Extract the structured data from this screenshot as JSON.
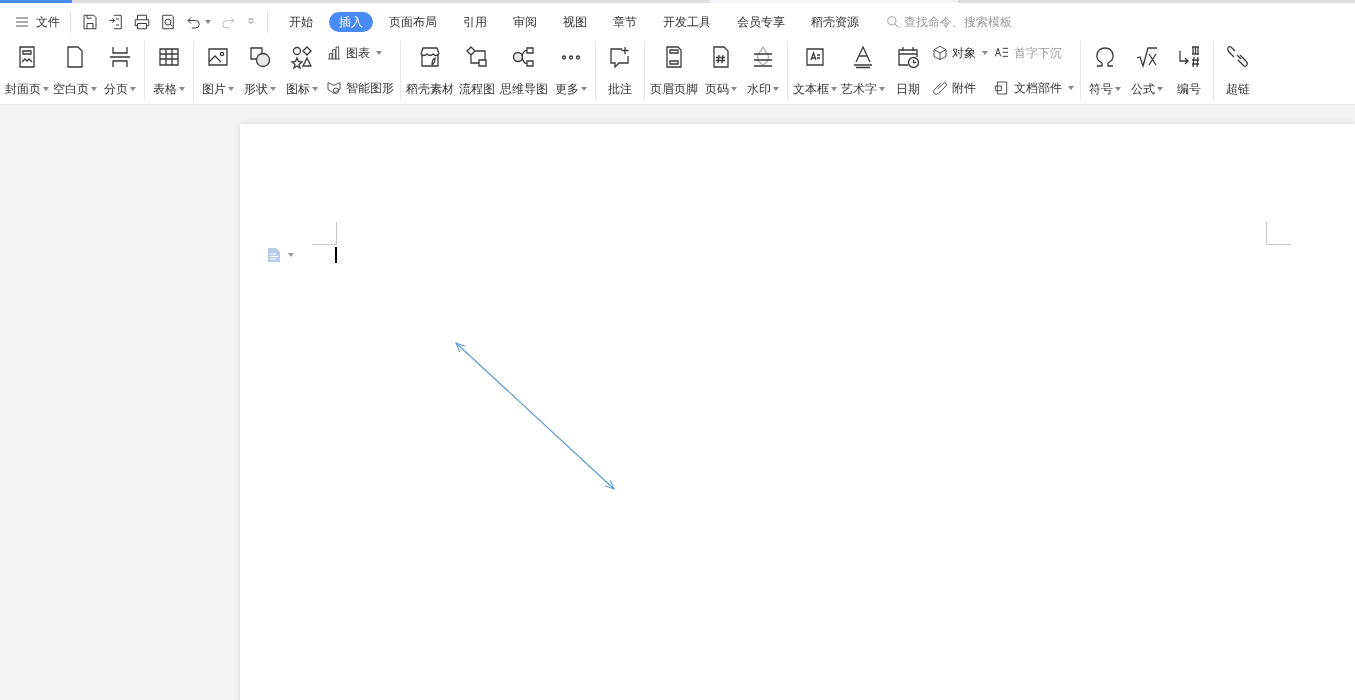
{
  "menu": {
    "label": "文件"
  },
  "quick_access": [
    {
      "disabled": false
    },
    {
      "disabled": false
    },
    {
      "disabled": false
    },
    {
      "disabled": false
    },
    {
      "disabled": false
    },
    {
      "disabled": true
    },
    {
      "disabled": false
    }
  ],
  "tabs": [
    {
      "label": "开始",
      "selected": false
    },
    {
      "label": "插入",
      "selected": true
    },
    {
      "label": "页面布局",
      "selected": false
    },
    {
      "label": "引用",
      "selected": false
    },
    {
      "label": "审阅",
      "selected": false
    },
    {
      "label": "视图",
      "selected": false
    },
    {
      "label": "章节",
      "selected": false
    },
    {
      "label": "开发工具",
      "selected": false
    },
    {
      "label": "会员专享",
      "selected": false
    },
    {
      "label": "稻壳资源",
      "selected": false
    }
  ],
  "search": {
    "placeholder": "查找命令、搜索模板"
  },
  "ribbon": {
    "groups": [
      {
        "items": [
          {
            "kind": "large",
            "label": "封面页",
            "dropdown": true
          },
          {
            "kind": "large",
            "label": "空白页",
            "dropdown": true
          },
          {
            "kind": "large",
            "label": "分页",
            "dropdown": true
          }
        ]
      },
      {
        "items": [
          {
            "kind": "large",
            "label": "表格",
            "dropdown": true
          }
        ]
      },
      {
        "items": [
          {
            "kind": "large",
            "label": "图片",
            "dropdown": true
          },
          {
            "kind": "large",
            "label": "形状",
            "dropdown": true
          },
          {
            "kind": "large",
            "label": "图标",
            "dropdown": true
          },
          {
            "kind": "stack",
            "items": [
              {
                "label": "图表",
                "dropdown": true,
                "disabled": false
              },
              {
                "label": "智能图形",
                "dropdown": false,
                "disabled": false
              }
            ]
          }
        ]
      },
      {
        "items": [
          {
            "kind": "large",
            "label": "稻壳素材",
            "dropdown": false
          },
          {
            "kind": "large",
            "label": "流程图",
            "dropdown": false
          },
          {
            "kind": "large",
            "label": "思维导图",
            "dropdown": false
          },
          {
            "kind": "large",
            "label": "更多",
            "dropdown": true
          }
        ]
      },
      {
        "items": [
          {
            "kind": "large",
            "label": "批注",
            "dropdown": false
          }
        ]
      },
      {
        "items": [
          {
            "kind": "large",
            "label": "页眉页脚",
            "dropdown": false
          },
          {
            "kind": "large",
            "label": "页码",
            "dropdown": true
          },
          {
            "kind": "large",
            "label": "水印",
            "dropdown": true
          }
        ]
      },
      {
        "items": [
          {
            "kind": "large",
            "label": "文本框",
            "dropdown": true
          },
          {
            "kind": "large",
            "label": "艺术字",
            "dropdown": true
          },
          {
            "kind": "large",
            "label": "日期",
            "dropdown": false
          },
          {
            "kind": "stack",
            "items": [
              {
                "label": "对象",
                "dropdown": true,
                "disabled": false
              },
              {
                "label": "附件",
                "dropdown": false,
                "disabled": false
              }
            ]
          },
          {
            "kind": "stack",
            "items": [
              {
                "label": "首字下沉",
                "dropdown": false,
                "disabled": true
              },
              {
                "label": "文档部件",
                "dropdown": true,
                "disabled": false
              }
            ]
          }
        ]
      },
      {
        "items": [
          {
            "kind": "large",
            "label": "符号",
            "dropdown": true
          },
          {
            "kind": "large",
            "label": "公式",
            "dropdown": true
          },
          {
            "kind": "large",
            "label": "编号",
            "dropdown": false
          }
        ]
      },
      {
        "items": [
          {
            "kind": "large",
            "label": "超链",
            "dropdown": false
          }
        ]
      }
    ]
  }
}
